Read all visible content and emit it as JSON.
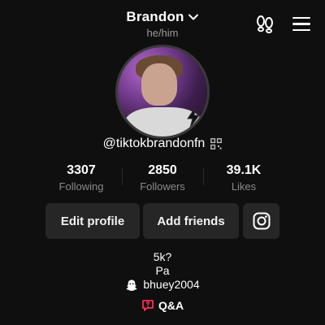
{
  "header": {
    "title": "Brandon",
    "pronouns": "he/him",
    "icons": [
      "chevron-down-icon",
      "footsteps-icon",
      "menu-icon"
    ]
  },
  "profile": {
    "handle": "@tiktokbrandonfn"
  },
  "stats": [
    {
      "value": "3307",
      "label": "Following"
    },
    {
      "value": "2850",
      "label": "Followers"
    },
    {
      "value": "39.1K",
      "label": "Likes"
    }
  ],
  "actions": {
    "edit_label": "Edit profile",
    "add_label": "Add friends",
    "instagram_icon": "instagram-icon"
  },
  "bio": {
    "line1": "5k?",
    "line2": "Pa",
    "link": "bhuey2004",
    "link_icon": "ghost-icon"
  },
  "qa": {
    "label": "Q&A",
    "icon": "qa-icon",
    "color": "#fe2c55"
  },
  "colors": {
    "background": "#0f0f0f",
    "button": "#262626",
    "muted": "#8a8a8a"
  }
}
